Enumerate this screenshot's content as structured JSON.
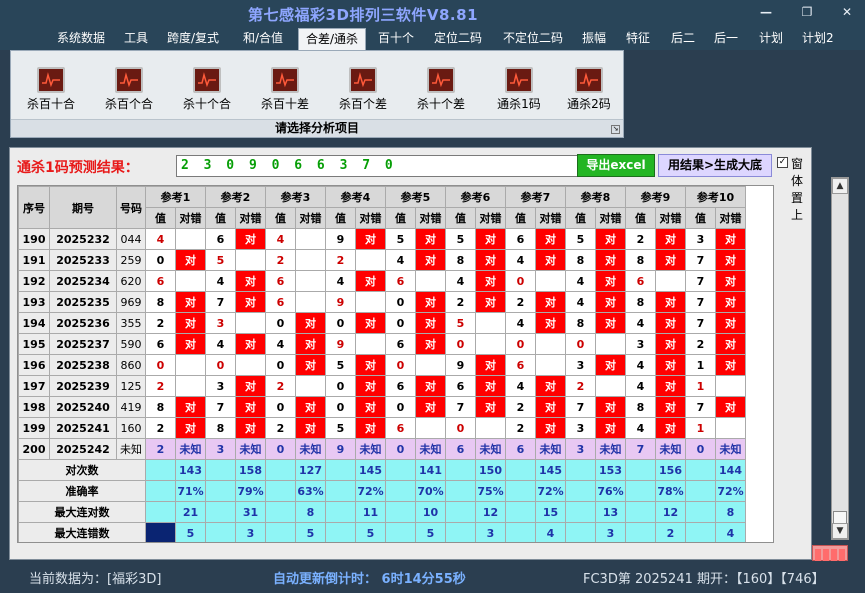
{
  "app": {
    "title": "第七感福彩3D排列三软件V8.81",
    "min_glyph": "—",
    "restore_glyph": "❐",
    "close_glyph": "✕"
  },
  "menu": [
    "系统数据",
    "工具",
    "跨度/复式",
    "和/合值",
    "合差/通杀",
    "百十个",
    "定位二码",
    "不定位二码",
    "振幅",
    "特征",
    "后二",
    "后一",
    "计划",
    "计划2"
  ],
  "menu_active_index": 4,
  "ribbon": {
    "buttons": [
      "杀百十合",
      "杀百个合",
      "杀十个合",
      "杀百十差",
      "杀百个差",
      "杀十个差",
      "通杀1码",
      "通杀2码"
    ],
    "caption": "请选择分析项目",
    "launcher_glyph": "↘"
  },
  "panel": {
    "result_label": "通杀1码预测结果：",
    "result_value": "2 3 0 9 0 6 6 3 7 0",
    "export_button": "导出excel",
    "generate_button": "用结果>生成大底",
    "checkbox_checked": true,
    "checkbox_label": "窗体置上"
  },
  "table": {
    "head_index": "序号",
    "head_period": "期号",
    "head_code": "号码",
    "ref_headers": [
      "参考1",
      "参考2",
      "参考3",
      "参考4",
      "参考5",
      "参考6",
      "参考7",
      "参考8",
      "参考9",
      "参考10"
    ],
    "sub_val": "值",
    "sub_hit": "对错",
    "hit_text": "对",
    "rows": [
      {
        "idx": "190",
        "period": "2025232",
        "code": "044",
        "v": [
          "4",
          "6",
          "4",
          "9",
          "5",
          "5",
          "6",
          "5",
          "2",
          "3"
        ],
        "r": [
          1,
          0,
          1,
          0,
          0,
          0,
          0,
          0,
          0,
          0
        ],
        "h": [
          0,
          1,
          0,
          1,
          1,
          1,
          1,
          1,
          1,
          1
        ]
      },
      {
        "idx": "191",
        "period": "2025233",
        "code": "259",
        "v": [
          "0",
          "5",
          "2",
          "2",
          "4",
          "8",
          "4",
          "8",
          "8",
          "7"
        ],
        "r": [
          0,
          1,
          1,
          1,
          0,
          0,
          0,
          0,
          0,
          0
        ],
        "h": [
          1,
          0,
          0,
          0,
          1,
          1,
          1,
          1,
          1,
          1
        ]
      },
      {
        "idx": "192",
        "period": "2025234",
        "code": "620",
        "v": [
          "6",
          "4",
          "6",
          "4",
          "6",
          "4",
          "0",
          "4",
          "6",
          "7"
        ],
        "r": [
          1,
          0,
          1,
          0,
          1,
          0,
          1,
          0,
          1,
          0
        ],
        "h": [
          0,
          1,
          0,
          1,
          0,
          1,
          0,
          1,
          0,
          1
        ]
      },
      {
        "idx": "193",
        "period": "2025235",
        "code": "969",
        "v": [
          "8",
          "7",
          "6",
          "9",
          "0",
          "2",
          "2",
          "4",
          "8",
          "7"
        ],
        "r": [
          0,
          0,
          1,
          1,
          0,
          0,
          0,
          0,
          0,
          0
        ],
        "h": [
          1,
          1,
          0,
          0,
          1,
          1,
          1,
          1,
          1,
          1
        ]
      },
      {
        "idx": "194",
        "period": "2025236",
        "code": "355",
        "v": [
          "2",
          "3",
          "0",
          "0",
          "0",
          "5",
          "4",
          "8",
          "4",
          "7"
        ],
        "r": [
          0,
          1,
          0,
          0,
          0,
          1,
          0,
          0,
          0,
          0
        ],
        "h": [
          1,
          0,
          1,
          1,
          1,
          0,
          1,
          1,
          1,
          1
        ]
      },
      {
        "idx": "195",
        "period": "2025237",
        "code": "590",
        "v": [
          "6",
          "4",
          "4",
          "9",
          "6",
          "0",
          "0",
          "0",
          "3",
          "2"
        ],
        "r": [
          0,
          0,
          0,
          1,
          0,
          1,
          1,
          1,
          0,
          0
        ],
        "h": [
          1,
          1,
          1,
          0,
          1,
          0,
          0,
          0,
          1,
          1
        ]
      },
      {
        "idx": "196",
        "period": "2025238",
        "code": "860",
        "v": [
          "0",
          "0",
          "0",
          "5",
          "0",
          "9",
          "6",
          "3",
          "4",
          "1"
        ],
        "r": [
          1,
          1,
          0,
          0,
          1,
          0,
          1,
          0,
          0,
          0
        ],
        "h": [
          0,
          0,
          1,
          1,
          0,
          1,
          0,
          1,
          1,
          1
        ]
      },
      {
        "idx": "197",
        "period": "2025239",
        "code": "125",
        "v": [
          "2",
          "3",
          "2",
          "0",
          "6",
          "6",
          "4",
          "2",
          "4",
          "1"
        ],
        "r": [
          1,
          0,
          1,
          0,
          0,
          0,
          0,
          1,
          0,
          1
        ],
        "h": [
          0,
          1,
          0,
          1,
          1,
          1,
          1,
          0,
          1,
          0
        ]
      },
      {
        "idx": "198",
        "period": "2025240",
        "code": "419",
        "v": [
          "8",
          "7",
          "0",
          "0",
          "0",
          "7",
          "2",
          "7",
          "8",
          "7"
        ],
        "r": [
          0,
          0,
          0,
          0,
          0,
          0,
          0,
          0,
          0,
          0
        ],
        "h": [
          1,
          1,
          1,
          1,
          1,
          1,
          1,
          1,
          1,
          1
        ]
      },
      {
        "idx": "199",
        "period": "2025241",
        "code": "160",
        "v": [
          "2",
          "8",
          "2",
          "5",
          "6",
          "0",
          "2",
          "3",
          "4",
          "1"
        ],
        "r": [
          0,
          0,
          0,
          0,
          1,
          1,
          0,
          0,
          0,
          1
        ],
        "h": [
          1,
          1,
          1,
          1,
          0,
          0,
          1,
          1,
          1,
          0
        ]
      }
    ],
    "pending_row": {
      "idx": "200",
      "period": "2025242",
      "code": "未知",
      "v": [
        "2",
        "3",
        "0",
        "9",
        "0",
        "6",
        "6",
        "3",
        "7",
        "0"
      ],
      "label": "未知"
    },
    "stats": [
      {
        "label": "对次数",
        "values": [
          "143",
          "158",
          "127",
          "145",
          "141",
          "150",
          "145",
          "153",
          "156",
          "144"
        ]
      },
      {
        "label": "准确率",
        "values": [
          "71%",
          "79%",
          "63%",
          "72%",
          "70%",
          "75%",
          "72%",
          "76%",
          "78%",
          "72%"
        ]
      },
      {
        "label": "最大连对数",
        "values": [
          "21",
          "31",
          "8",
          "11",
          "10",
          "12",
          "15",
          "13",
          "12",
          "8"
        ]
      },
      {
        "label": "最大连错数",
        "values": [
          "5",
          "3",
          "5",
          "5",
          "5",
          "3",
          "4",
          "3",
          "2",
          "4"
        ]
      }
    ]
  },
  "status": {
    "current_data": "当前数据为：[福彩3D]",
    "countdown": "自动更新倒计时： 6时14分55秒",
    "issue": "FC3D第 2025241 期开：【160】【746】"
  },
  "colors": {
    "hit": "#ff0000",
    "stat_bg": "#8ff5f5",
    "pending_bg": "#e8c8f3",
    "titlebar": "#294559"
  }
}
